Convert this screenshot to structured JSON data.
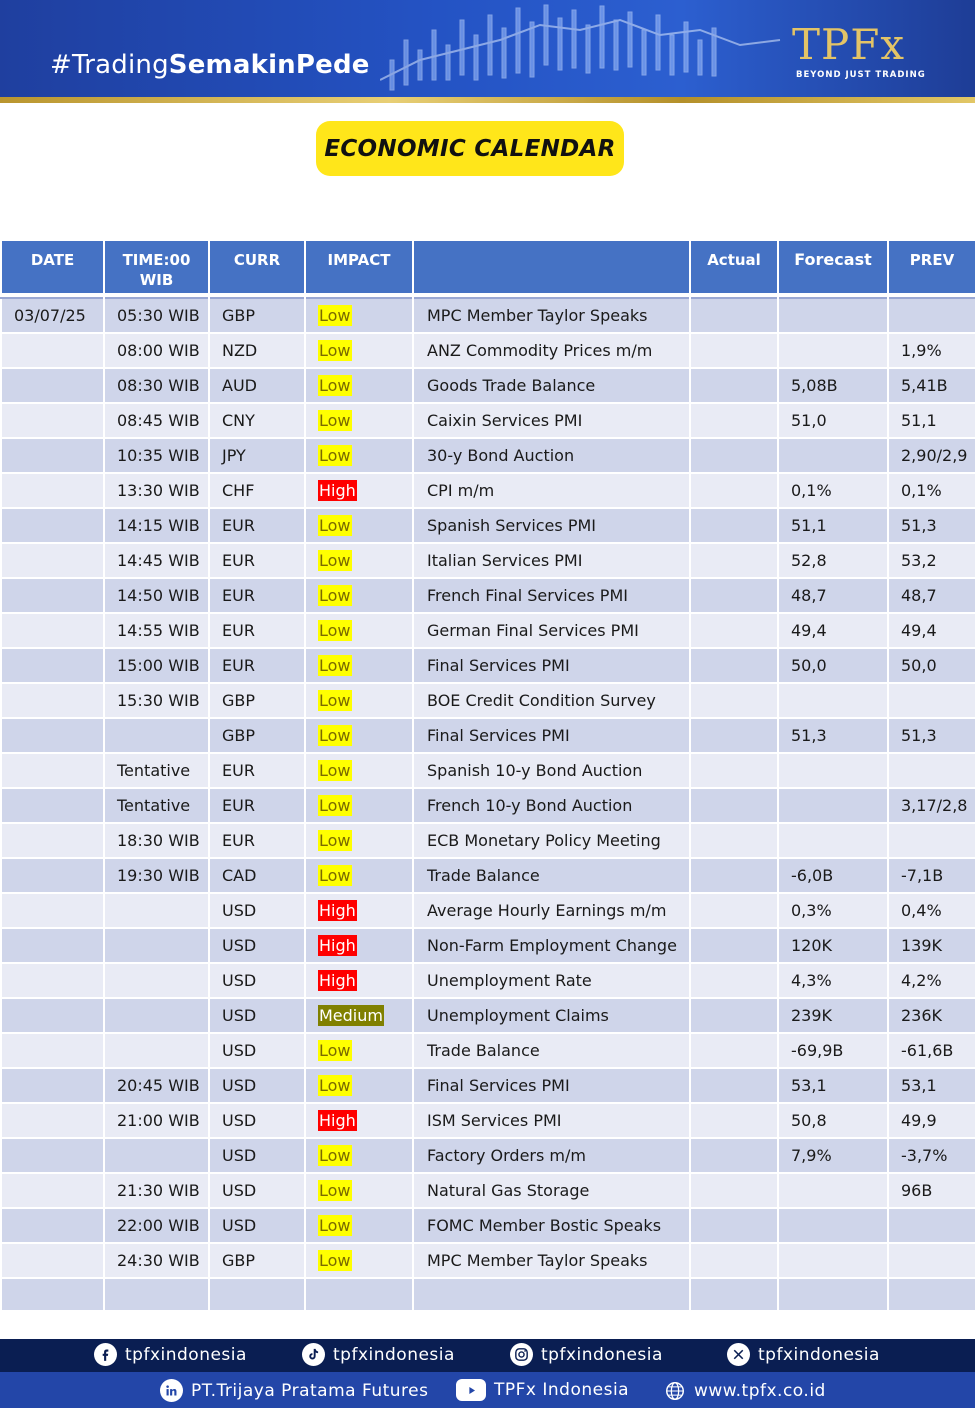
{
  "header": {
    "hashtag_prefix": "#Trading",
    "hashtag_bold": "SemakinPede",
    "logo_text": "TPFx",
    "logo_tagline": "BEYOND JUST TRADING",
    "accent_gold": "#e3c467"
  },
  "title": "ECONOMIC CALENDAR",
  "table": {
    "headers": {
      "date": "DATE",
      "time_line1": "TIME:00",
      "time_line2": "WIB",
      "curr": "CURR",
      "impact": "IMPACT",
      "event": "",
      "actual": "Actual",
      "forecast": "Forecast",
      "prev": "PREV"
    },
    "rows": [
      {
        "date": "03/07/25",
        "time": "05:30 WIB",
        "curr": "GBP",
        "impact": "Low",
        "event": "MPC Member Taylor Speaks",
        "actual": "",
        "forecast": "",
        "prev": ""
      },
      {
        "date": "",
        "time": "08:00 WIB",
        "curr": "NZD",
        "impact": "Low",
        "event": "ANZ Commodity Prices m/m",
        "actual": "",
        "forecast": "",
        "prev": "1,9%"
      },
      {
        "date": "",
        "time": "08:30 WIB",
        "curr": "AUD",
        "impact": "Low",
        "event": "Goods Trade Balance",
        "actual": "",
        "forecast": "5,08B",
        "prev": "5,41B"
      },
      {
        "date": "",
        "time": "08:45 WIB",
        "curr": "CNY",
        "impact": "Low",
        "event": "Caixin Services PMI",
        "actual": "",
        "forecast": "51,0",
        "prev": "51,1"
      },
      {
        "date": "",
        "time": "10:35 WIB",
        "curr": "JPY",
        "impact": "Low",
        "event": "30-y Bond Auction",
        "actual": "",
        "forecast": "",
        "prev": "2,90/2,9"
      },
      {
        "date": "",
        "time": "13:30 WIB",
        "curr": "CHF",
        "impact": "High",
        "event": "CPI m/m",
        "actual": "",
        "forecast": "0,1%",
        "prev": "0,1%"
      },
      {
        "date": "",
        "time": "14:15 WIB",
        "curr": "EUR",
        "impact": "Low",
        "event": "Spanish Services PMI",
        "actual": "",
        "forecast": "51,1",
        "prev": "51,3"
      },
      {
        "date": "",
        "time": "14:45 WIB",
        "curr": "EUR",
        "impact": "Low",
        "event": "Italian Services PMI",
        "actual": "",
        "forecast": "52,8",
        "prev": "53,2"
      },
      {
        "date": "",
        "time": "14:50 WIB",
        "curr": "EUR",
        "impact": "Low",
        "event": "French Final Services PMI",
        "actual": "",
        "forecast": "48,7",
        "prev": "48,7"
      },
      {
        "date": "",
        "time": "14:55 WIB",
        "curr": "EUR",
        "impact": "Low",
        "event": "German Final Services PMI",
        "actual": "",
        "forecast": "49,4",
        "prev": "49,4"
      },
      {
        "date": "",
        "time": "15:00 WIB",
        "curr": "EUR",
        "impact": "Low",
        "event": "Final Services PMI",
        "actual": "",
        "forecast": "50,0",
        "prev": "50,0"
      },
      {
        "date": "",
        "time": "15:30 WIB",
        "curr": "GBP",
        "impact": "Low",
        "event": "BOE Credit Condition Survey",
        "actual": "",
        "forecast": "",
        "prev": ""
      },
      {
        "date": "",
        "time": "",
        "curr": "GBP",
        "impact": "Low",
        "event": "Final Services PMI",
        "actual": "",
        "forecast": "51,3",
        "prev": "51,3"
      },
      {
        "date": "",
        "time": "Tentative",
        "curr": "EUR",
        "impact": "Low",
        "event": "Spanish 10-y Bond Auction",
        "actual": "",
        "forecast": "",
        "prev": ""
      },
      {
        "date": "",
        "time": "Tentative",
        "curr": "EUR",
        "impact": "Low",
        "event": "French 10-y Bond Auction",
        "actual": "",
        "forecast": "",
        "prev": "3,17/2,8"
      },
      {
        "date": "",
        "time": "18:30 WIB",
        "curr": "EUR",
        "impact": "Low",
        "event": "ECB Monetary Policy Meeting",
        "actual": "",
        "forecast": "",
        "prev": ""
      },
      {
        "date": "",
        "time": "19:30 WIB",
        "curr": "CAD",
        "impact": "Low",
        "event": "Trade Balance",
        "actual": "",
        "forecast": "-6,0B",
        "prev": "-7,1B"
      },
      {
        "date": "",
        "time": "",
        "curr": "USD",
        "impact": "High",
        "event": "Average Hourly Earnings m/m",
        "actual": "",
        "forecast": "0,3%",
        "prev": "0,4%"
      },
      {
        "date": "",
        "time": "",
        "curr": "USD",
        "impact": "High",
        "event": "Non-Farm Employment Change",
        "actual": "",
        "forecast": "120K",
        "prev": "139K"
      },
      {
        "date": "",
        "time": "",
        "curr": "USD",
        "impact": "High",
        "event": "Unemployment Rate",
        "actual": "",
        "forecast": "4,3%",
        "prev": "4,2%"
      },
      {
        "date": "",
        "time": "",
        "curr": "USD",
        "impact": "Medium",
        "event": "Unemployment Claims",
        "actual": "",
        "forecast": "239K",
        "prev": "236K"
      },
      {
        "date": "",
        "time": "",
        "curr": "USD",
        "impact": "Low",
        "event": "Trade Balance",
        "actual": "",
        "forecast": "-69,9B",
        "prev": "-61,6B"
      },
      {
        "date": "",
        "time": "20:45 WIB",
        "curr": "USD",
        "impact": "Low",
        "event": "Final Services PMI",
        "actual": "",
        "forecast": "53,1",
        "prev": "53,1"
      },
      {
        "date": "",
        "time": "21:00 WIB",
        "curr": "USD",
        "impact": "High",
        "event": "ISM Services PMI",
        "actual": "",
        "forecast": "50,8",
        "prev": "49,9"
      },
      {
        "date": "",
        "time": "",
        "curr": "USD",
        "impact": "Low",
        "event": "Factory Orders m/m",
        "actual": "",
        "forecast": "7,9%",
        "prev": "-3,7%"
      },
      {
        "date": "",
        "time": "21:30 WIB",
        "curr": "USD",
        "impact": "Low",
        "event": "Natural Gas Storage",
        "actual": "",
        "forecast": "",
        "prev": "96B"
      },
      {
        "date": "",
        "time": "22:00 WIB",
        "curr": "USD",
        "impact": "Low",
        "event": "FOMC Member Bostic Speaks",
        "actual": "",
        "forecast": "",
        "prev": ""
      },
      {
        "date": "",
        "time": "24:30 WIB",
        "curr": "GBP",
        "impact": "Low",
        "event": "MPC Member Taylor Speaks",
        "actual": "",
        "forecast": "",
        "prev": ""
      },
      {
        "date": "",
        "time": "",
        "curr": "",
        "impact": "",
        "event": "",
        "actual": "",
        "forecast": "",
        "prev": ""
      }
    ]
  },
  "impact_colors": {
    "Low": "#ffff00",
    "High": "#ff0000",
    "Medium": "#808000"
  },
  "footer": {
    "socials": [
      {
        "icon": "facebook-icon",
        "label": "tpfxindonesia"
      },
      {
        "icon": "tiktok-icon",
        "label": "tpfxindonesia"
      },
      {
        "icon": "instagram-icon",
        "label": "tpfxindonesia"
      },
      {
        "icon": "x-icon",
        "label": "tpfxindonesia"
      }
    ],
    "links": [
      {
        "icon": "linkedin-icon",
        "label": "PT.Trijaya Pratama Futures"
      },
      {
        "icon": "youtube-icon",
        "label": "TPFx Indonesia"
      },
      {
        "icon": "globe-icon",
        "label": "www.tpfx.co.id"
      }
    ]
  }
}
